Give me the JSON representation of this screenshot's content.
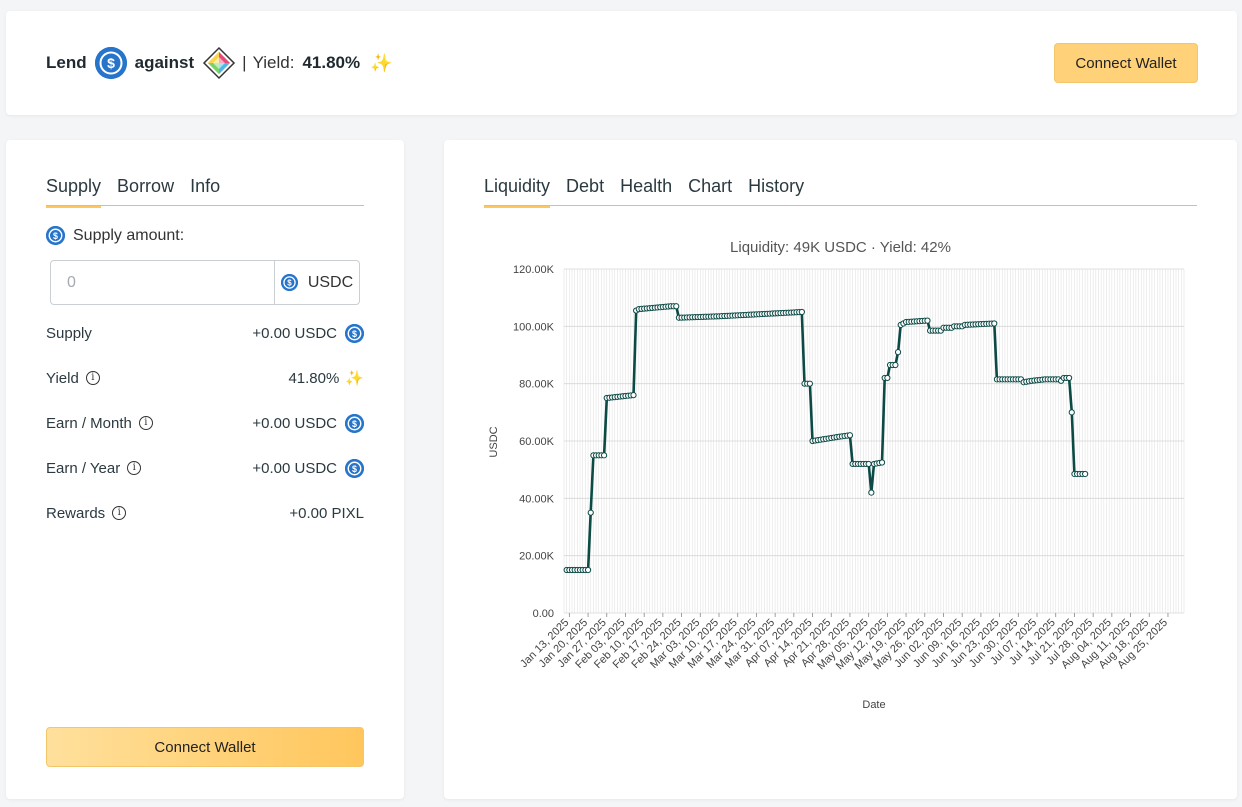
{
  "header": {
    "lend_label": "Lend",
    "against_label": "against",
    "separator": "|",
    "yield_label": "Yield:",
    "yield_value": "41.80%",
    "connect_label": "Connect Wallet"
  },
  "left": {
    "tabs": [
      "Supply",
      "Borrow",
      "Info"
    ],
    "supply_amount_label": "Supply amount:",
    "input_placeholder": "0",
    "input_unit": "USDC",
    "rows": [
      {
        "label": "Supply",
        "value": "+0.00 USDC"
      },
      {
        "label": "Yield",
        "value": "41.80%"
      },
      {
        "label": "Earn / Month",
        "value": "+0.00 USDC"
      },
      {
        "label": "Earn / Year",
        "value": "+0.00 USDC"
      },
      {
        "label": "Rewards",
        "value": "+0.00 PIXL"
      }
    ],
    "connect_label": "Connect Wallet"
  },
  "right": {
    "tabs": [
      "Liquidity",
      "Debt",
      "Health",
      "Chart",
      "History"
    ]
  },
  "colors": {
    "accent": "#ffc65c",
    "usdc": "#2775ca",
    "line": "#0b4a45"
  },
  "chart_data": {
    "type": "line",
    "title": "Liquidity: 49K USDC · Yield: 42%",
    "xlabel": "Date",
    "ylabel": "USDC",
    "ylim": [
      0,
      120000
    ],
    "yticks": [
      "0.00",
      "20.00K",
      "40.00K",
      "60.00K",
      "80.00K",
      "100.00K",
      "120.00K"
    ],
    "x_range": [
      "2025-01-11",
      "2025-08-31"
    ],
    "xticks": [
      "Jan 13, 2025",
      "Jan 20, 2025",
      "Jan 27, 2025",
      "Feb 03, 2025",
      "Feb 10, 2025",
      "Feb 17, 2025",
      "Feb 24, 2025",
      "Mar 03, 2025",
      "Mar 10, 2025",
      "Mar 17, 2025",
      "Mar 24, 2025",
      "Mar 31, 2025",
      "Apr 07, 2025",
      "Apr 14, 2025",
      "Apr 21, 2025",
      "Apr 28, 2025",
      "May 05, 2025",
      "May 12, 2025",
      "May 19, 2025",
      "May 26, 2025",
      "Jun 02, 2025",
      "Jun 09, 2025",
      "Jun 16, 2025",
      "Jun 23, 2025",
      "Jun 30, 2025",
      "Jul 07, 2025",
      "Jul 14, 2025",
      "Jul 21, 2025",
      "Jul 28, 2025",
      "Aug 04, 2025",
      "Aug 11, 2025",
      "Aug 18, 2025",
      "Aug 25, 2025"
    ],
    "grid": true,
    "series": [
      {
        "points": [
          [
            "2025-01-12",
            15000
          ],
          [
            "2025-01-20",
            15000
          ],
          [
            "2025-01-21",
            35000
          ],
          [
            "2025-01-22",
            55000
          ],
          [
            "2025-01-26",
            55000
          ],
          [
            "2025-01-27",
            75000
          ],
          [
            "2025-02-06",
            76000
          ],
          [
            "2025-02-07",
            105500
          ],
          [
            "2025-02-08",
            106000
          ],
          [
            "2025-02-20",
            107000
          ],
          [
            "2025-02-22",
            107000
          ],
          [
            "2025-02-23",
            103000
          ],
          [
            "2025-03-10",
            103500
          ],
          [
            "2025-04-10",
            105000
          ],
          [
            "2025-04-11",
            80000
          ],
          [
            "2025-04-13",
            80000
          ],
          [
            "2025-04-14",
            60000
          ],
          [
            "2025-04-24",
            61500
          ],
          [
            "2025-04-28",
            62000
          ],
          [
            "2025-04-29",
            52000
          ],
          [
            "2025-05-05",
            52000
          ],
          [
            "2025-05-06",
            42000
          ],
          [
            "2025-05-07",
            52000
          ],
          [
            "2025-05-10",
            52500
          ],
          [
            "2025-05-11",
            82000
          ],
          [
            "2025-05-12",
            82000
          ],
          [
            "2025-05-13",
            86500
          ],
          [
            "2025-05-15",
            86500
          ],
          [
            "2025-05-16",
            91000
          ],
          [
            "2025-05-17",
            100500
          ],
          [
            "2025-05-19",
            101500
          ],
          [
            "2025-05-27",
            102000
          ],
          [
            "2025-05-28",
            98500
          ],
          [
            "2025-06-01",
            98500
          ],
          [
            "2025-06-02",
            99500
          ],
          [
            "2025-06-05",
            99500
          ],
          [
            "2025-06-06",
            100000
          ],
          [
            "2025-06-09",
            100000
          ],
          [
            "2025-06-10",
            100500
          ],
          [
            "2025-06-21",
            101000
          ],
          [
            "2025-06-22",
            81500
          ],
          [
            "2025-07-01",
            81500
          ],
          [
            "2025-07-02",
            80500
          ],
          [
            "2025-07-05",
            81000
          ],
          [
            "2025-07-10",
            81500
          ],
          [
            "2025-07-15",
            81500
          ],
          [
            "2025-07-16",
            81000
          ],
          [
            "2025-07-17",
            82000
          ],
          [
            "2025-07-19",
            82000
          ],
          [
            "2025-07-20",
            70000
          ],
          [
            "2025-07-21",
            48500
          ],
          [
            "2025-07-25",
            48500
          ]
        ]
      }
    ]
  }
}
